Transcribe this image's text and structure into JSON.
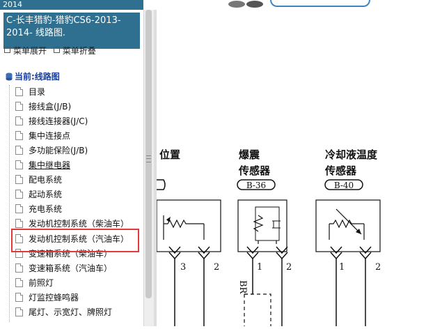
{
  "window": {
    "title_strip": "2014",
    "sidebar_title": "C-长丰猎豹-猎豹CS6-2013-2014- 线路图."
  },
  "menu": {
    "expand_label": "菜单展开",
    "collapse_label": "菜单折叠"
  },
  "tree": {
    "current_label": "当前:线路图",
    "items": [
      {
        "label": "目录"
      },
      {
        "label": "接线盒(J/B)"
      },
      {
        "label": "接线连接器(J/C)"
      },
      {
        "label": "集中连接点"
      },
      {
        "label": "多功能保险(J/B)"
      },
      {
        "label": "集中继电器"
      },
      {
        "label": "配电系统"
      },
      {
        "label": "起动系统"
      },
      {
        "label": "充电系统"
      },
      {
        "label": "发动机控制系统（柴油车）"
      },
      {
        "label": "发动机控制系统（汽油车）"
      },
      {
        "label": "变速箱系统（柴油车）"
      },
      {
        "label": "变速箱系统（汽油车）"
      },
      {
        "label": "前照灯"
      },
      {
        "label": "灯监控蜂鸣器"
      },
      {
        "label": "尾灯、示宽灯、牌照灯"
      }
    ],
    "selected_index": 10
  },
  "diagram": {
    "sensors": [
      {
        "title_line1": "位置",
        "title_line2": "",
        "connector": ""
      },
      {
        "title_line1": "爆震",
        "title_line2": "传感器",
        "connector": "B-36"
      },
      {
        "title_line1": "冷却液温度",
        "title_line2": "传感器",
        "connector": "B-40"
      }
    ],
    "pins": [
      "3",
      "2",
      "1",
      "2",
      "1",
      "2"
    ],
    "wire_label": "BR"
  },
  "colors": {
    "title_bg": "#2f6f8f",
    "highlight": "#e23a3a",
    "link_blue": "#1a3e9c"
  }
}
